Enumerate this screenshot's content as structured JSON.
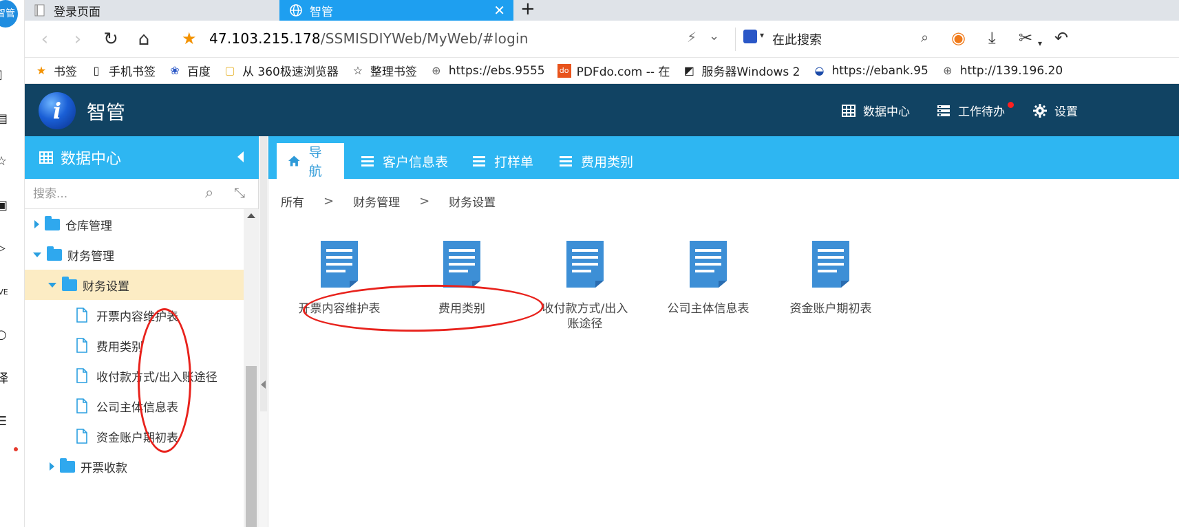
{
  "browser": {
    "rail_logo_text": "智管",
    "tabs": [
      {
        "label": "登录页面",
        "active": false
      },
      {
        "label": "智管",
        "active": true
      }
    ],
    "new_tab_symbol": "+",
    "address": {
      "host": "47.103.215.178",
      "path": "/SSMISDIYWeb/MyWeb/#login"
    },
    "search_placeholder": "在此搜索",
    "bookmarks": [
      {
        "label": "书签",
        "icon": "star-icon"
      },
      {
        "label": "手机书签",
        "icon": "phone-icon"
      },
      {
        "label": "百度",
        "icon": "baidu-icon"
      },
      {
        "label": "从 360极速浏览器",
        "icon": "folder-icon"
      },
      {
        "label": "整理书签",
        "icon": "star-outline-icon"
      },
      {
        "label": "https://ebs.9555",
        "icon": "globe-icon"
      },
      {
        "label": "PDFdo.com -- 在",
        "icon": "pdfdo-icon"
      },
      {
        "label": "服务器Windows 2",
        "icon": "server-icon"
      },
      {
        "label": "https://ebank.95",
        "icon": "bank-icon"
      },
      {
        "label": "http://139.196.20",
        "icon": "globe-icon"
      }
    ]
  },
  "app": {
    "logo_letter": "i",
    "title": "智管",
    "header_links": [
      {
        "label": "数据中心",
        "icon": "grid-icon"
      },
      {
        "label": "工作待办",
        "icon": "list-icon",
        "has_notification": true
      },
      {
        "label": "设置",
        "icon": "gear-icon"
      }
    ]
  },
  "sidebar": {
    "title": "数据中心",
    "search_placeholder": "搜索...",
    "tree": [
      {
        "label": "仓库管理",
        "type": "folder",
        "level": 0,
        "expanded": false
      },
      {
        "label": "财务管理",
        "type": "folder",
        "level": 0,
        "expanded": true
      },
      {
        "label": "财务设置",
        "type": "folder",
        "level": 1,
        "expanded": true,
        "selected": true
      },
      {
        "label": "开票内容维护表",
        "type": "file",
        "level": 2
      },
      {
        "label": "费用类别",
        "type": "file",
        "level": 2
      },
      {
        "label": "收付款方式/出入账途径",
        "type": "file",
        "level": 2
      },
      {
        "label": "公司主体信息表",
        "type": "file",
        "level": 2
      },
      {
        "label": "资金账户期初表",
        "type": "file",
        "level": 2
      },
      {
        "label": "开票收款",
        "type": "folder",
        "level": 1,
        "expanded": false
      }
    ]
  },
  "main": {
    "tabs": [
      {
        "label": "导航",
        "icon": "home-icon",
        "active": true
      },
      {
        "label": "客户信息表",
        "icon": "menu-icon",
        "active": false
      },
      {
        "label": "打样单",
        "icon": "menu-icon",
        "active": false
      },
      {
        "label": "费用类别",
        "icon": "menu-icon",
        "active": false
      }
    ],
    "breadcrumb": [
      "所有",
      "财务管理",
      "财务设置"
    ],
    "breadcrumb_separator": ">",
    "documents": [
      {
        "label": "开票内容维护表"
      },
      {
        "label": "费用类别"
      },
      {
        "label": "收付款方式/出入账途径"
      },
      {
        "label": "公司主体信息表"
      },
      {
        "label": "资金账户期初表"
      }
    ]
  },
  "colors": {
    "header_bg": "#114363",
    "accent": "#2eb6f2",
    "active_tab_text": "#2e9ad8",
    "selected_row": "#fcecc4",
    "doc_icon": "#3d8fd6",
    "annotation": "#e8221c"
  }
}
